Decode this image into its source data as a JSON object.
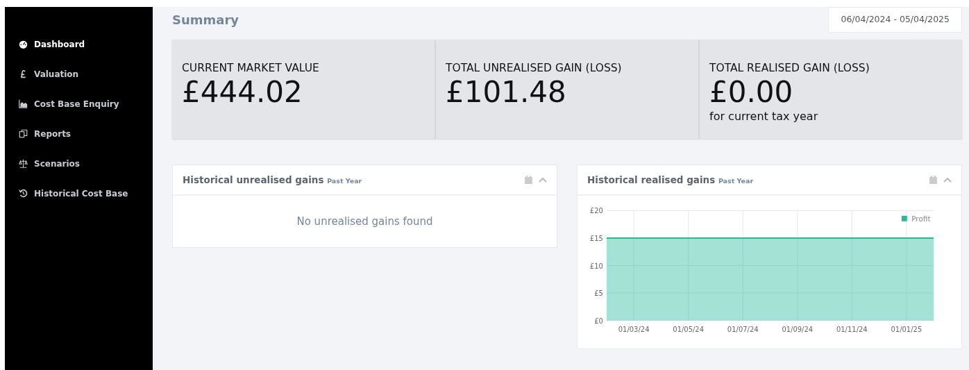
{
  "sidebar": {
    "items": [
      {
        "label": "Dashboard",
        "selected": true
      },
      {
        "label": "Valuation",
        "selected": false
      },
      {
        "label": "Cost Base Enquiry",
        "selected": false
      },
      {
        "label": "Reports",
        "selected": false
      },
      {
        "label": "Scenarios",
        "selected": false
      },
      {
        "label": "Historical Cost Base",
        "selected": false
      }
    ]
  },
  "header": {
    "title": "Summary",
    "date_range": "06/04/2024 - 05/04/2025"
  },
  "stats": [
    {
      "label": "CURRENT MARKET VALUE",
      "value": "£444.02"
    },
    {
      "label": "TOTAL UNREALISED GAIN (LOSS)",
      "value": "£101.48"
    },
    {
      "label": "TOTAL REALISED GAIN (LOSS)",
      "value": "£0.00",
      "note": "for current tax year"
    }
  ],
  "panels": [
    {
      "title": "Historical unrealised gains",
      "period": "Past Year",
      "empty_message": "No unrealised gains found"
    },
    {
      "title": "Historical realised gains",
      "period": "Past Year",
      "chart_data": {
        "type": "area",
        "grid": true,
        "categories": [
          null,
          "01/03/24",
          null,
          "01/05/24",
          null,
          "01/07/24",
          null,
          "01/09/24",
          null,
          "01/11/24",
          null,
          "01/01/25",
          null
        ],
        "ylim": [
          0,
          20
        ],
        "series": [
          {
            "name": "Profit",
            "color": "#26b99a",
            "values": [
              15,
              15,
              15,
              15,
              15,
              15,
              15,
              15,
              15,
              15,
              15,
              15,
              15
            ]
          }
        ],
        "yticks": [
          {
            "value": 0,
            "label": "£0"
          },
          {
            "value": 5,
            "label": "£5"
          },
          {
            "value": 10,
            "label": "£10"
          },
          {
            "value": 15,
            "label": "£15"
          },
          {
            "value": 20,
            "label": "£20"
          }
        ]
      }
    }
  ]
}
